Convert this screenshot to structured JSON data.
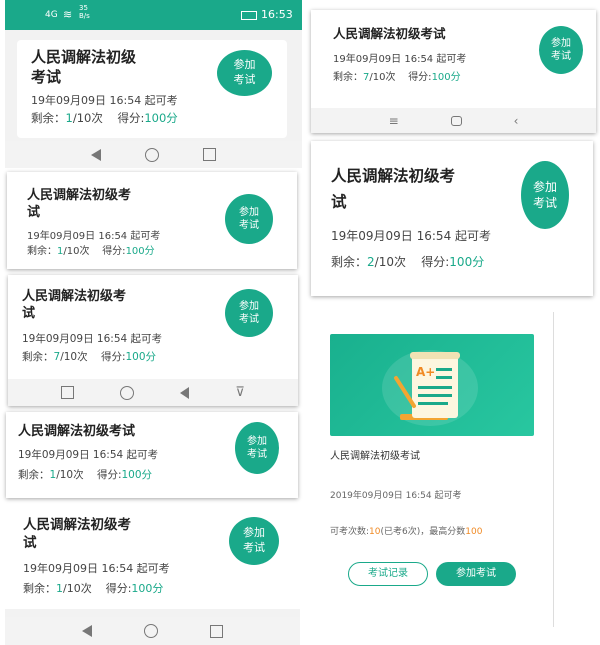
{
  "status_bar": {
    "signal": "4G",
    "speed_top": "35",
    "speed_bottom": "B/s",
    "time": "16:53"
  },
  "card_title": "人民调解法初级考试",
  "title_line1": "人民调解法初级考",
  "title_line2": "试",
  "title_alt_line1": "人民调解法初级",
  "title_alt_line2": "考试",
  "join_line1": "参加",
  "join_line2": "考试",
  "date_text": "19年09月09日 16:54 起可考",
  "date_text_spaced": "19年09月09日 16:54 起可考",
  "remaining_label": "剩余：",
  "remaining_label_colon": "剩余：",
  "score_label": "得分:",
  "score_value": "100分",
  "remaining_1": "1",
  "remaining_2": "2",
  "remaining_7": "7",
  "total": "/10次",
  "nav_icons": [
    "back-icon",
    "home-icon",
    "recent-apps-icon",
    "menu-icon"
  ],
  "panel10": {
    "title": "人民调解法初级考试",
    "date": "2019年09月09日 16:54 起可考",
    "info_prefix": "可考次数:",
    "info_count": "10",
    "info_mid": "(已考6次)，最高分数",
    "info_score": "100",
    "record_button": "考试记录",
    "join_button": "参加考试",
    "banner_badge": "A+"
  },
  "colors": {
    "accent": "#1aa98a",
    "orange": "#f08a24",
    "navbar": "#f3f3f3"
  }
}
